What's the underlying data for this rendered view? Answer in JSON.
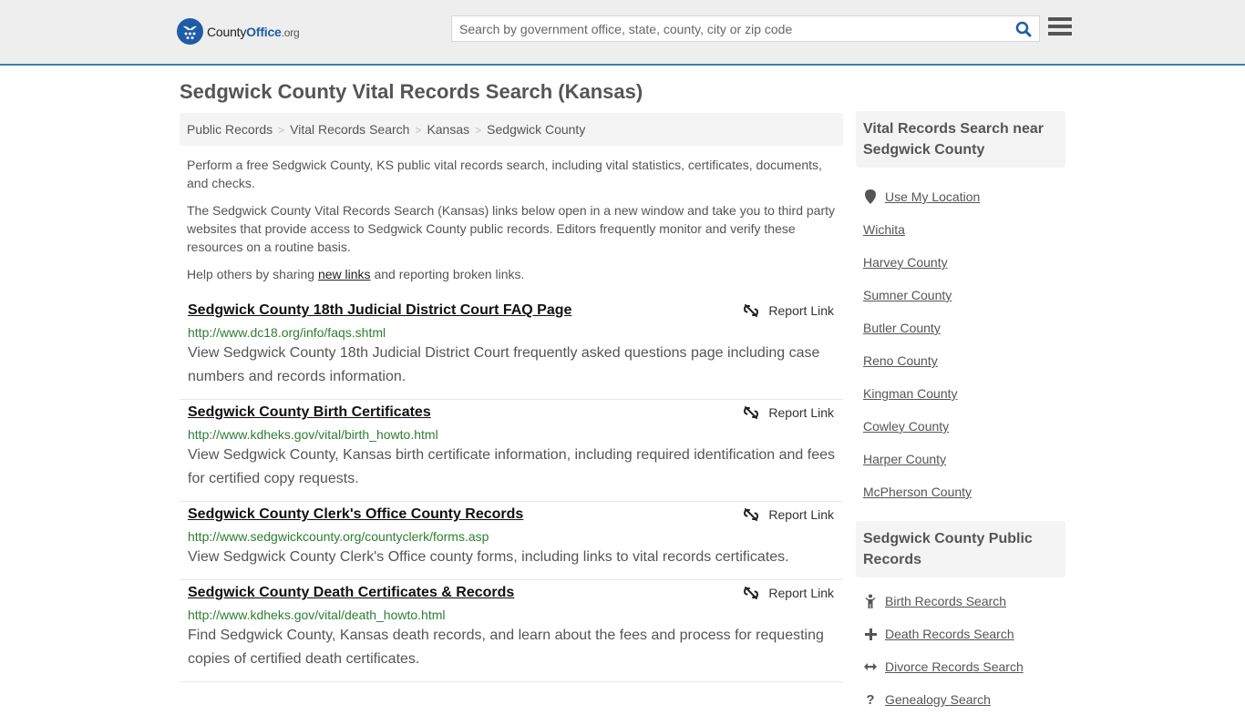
{
  "header": {
    "logo": {
      "part1": "County",
      "part2": "Office",
      "part3": ".org"
    },
    "search": {
      "placeholder": "Search by government office, state, county, city or zip code",
      "value": ""
    },
    "colors": {
      "brand": "#1f5ca8",
      "topbar_border": "#3b7eb0",
      "url_green": "#2e7d32"
    }
  },
  "page": {
    "title": "Sedgwick County Vital Records Search (Kansas)"
  },
  "breadcrumb": [
    {
      "label": "Public Records"
    },
    {
      "label": "Vital Records Search"
    },
    {
      "label": "Kansas"
    },
    {
      "label": "Sedgwick County"
    }
  ],
  "breadcrumb_separator": ">",
  "intro": {
    "p1": "Perform a free Sedgwick County, KS public vital records search, including vital statistics, certificates, documents, and checks.",
    "p2": "The Sedgwick County Vital Records Search (Kansas) links below open in a new window and take you to third party websites that provide access to Sedgwick County public records. Editors frequently monitor and verify these resources on a routine basis.",
    "p3_before": "Help others by sharing ",
    "p3_link": "new links",
    "p3_after": " and reporting broken links."
  },
  "report_label": "Report Link",
  "results": [
    {
      "title": "Sedgwick County 18th Judicial District Court FAQ Page",
      "url": "http://www.dc18.org/info/faqs.shtml",
      "description": "View Sedgwick County 18th Judicial District Court frequently asked questions page including case numbers and records information."
    },
    {
      "title": "Sedgwick County Birth Certificates",
      "url": "http://www.kdheks.gov/vital/birth_howto.html",
      "description": "View Sedgwick County, Kansas birth certificate information, including required identification and fees for certified copy requests."
    },
    {
      "title": "Sedgwick County Clerk's Office County Records",
      "url": "http://www.sedgwickcounty.org/countyclerk/forms.asp",
      "description": "View Sedgwick County Clerk's Office county forms, including links to vital records certificates."
    },
    {
      "title": "Sedgwick County Death Certificates & Records",
      "url": "http://www.kdheks.gov/vital/death_howto.html",
      "description": "Find Sedgwick County, Kansas death records, and learn about the fees and process for requesting copies of certified death certificates."
    }
  ],
  "sidebar": {
    "nearby": {
      "heading": "Vital Records Search near Sedgwick County",
      "use_location": "Use My Location",
      "items": [
        "Wichita",
        "Harvey County",
        "Sumner County",
        "Butler County",
        "Reno County",
        "Kingman County",
        "Cowley County",
        "Harper County",
        "McPherson County"
      ]
    },
    "public_records": {
      "heading": "Sedgwick County Public Records",
      "items": [
        {
          "label": "Birth Records Search",
          "icon": "child-icon"
        },
        {
          "label": "Death Records Search",
          "icon": "plus-icon"
        },
        {
          "label": "Divorce Records Search",
          "icon": "arrows-horizontal-icon"
        },
        {
          "label": "Genealogy Search",
          "icon": "question-icon"
        }
      ]
    }
  }
}
